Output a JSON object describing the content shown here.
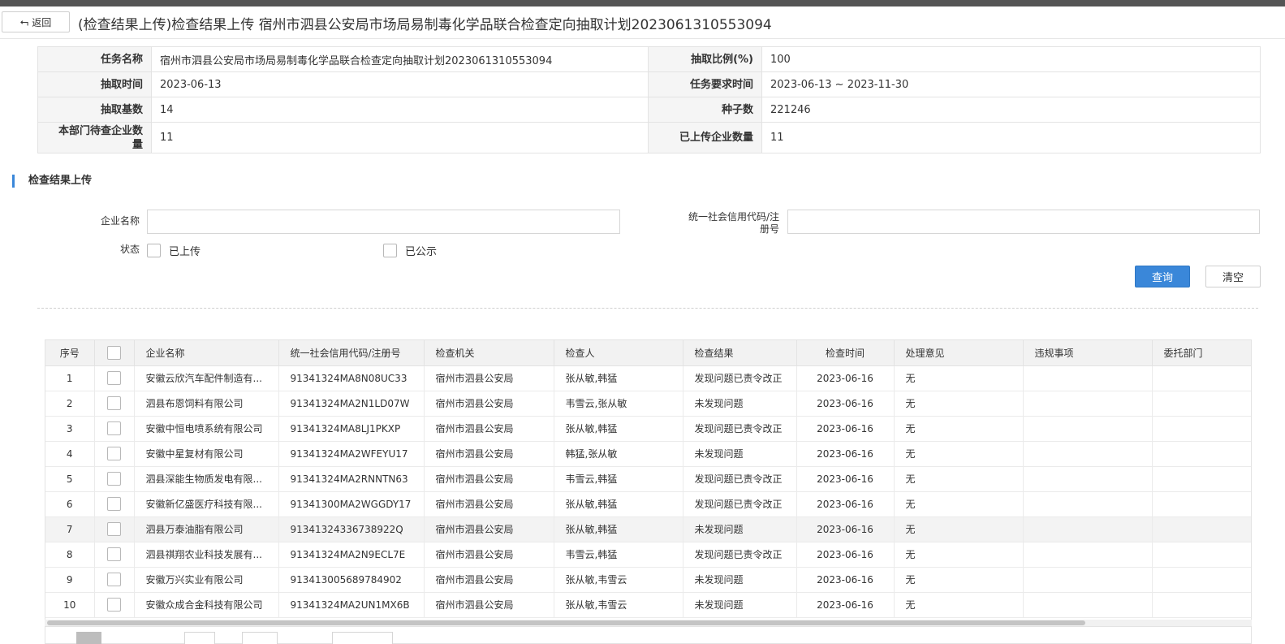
{
  "header": {
    "back_label": "返回",
    "title": "(检查结果上传)检查结果上传 宿州市泗县公安局市场局易制毒化学品联合检查定向抽取计划2023061310553094"
  },
  "info": {
    "task_name_label": "任务名称",
    "task_name": "宿州市泗县公安局市场局易制毒化学品联合检查定向抽取计划2023061310553094",
    "ratio_label": "抽取比例(%)",
    "ratio": "100",
    "extract_time_label": "抽取时间",
    "extract_time": "2023-06-13",
    "required_time_label": "任务要求时间",
    "required_time": "2023-06-13 ~ 2023-11-30",
    "base_count_label": "抽取基数",
    "base_count": "14",
    "seed_label": "种子数",
    "seed": "221246",
    "pending_label_1": "本部门待查企业数",
    "pending_label_2": "量",
    "pending": "11",
    "uploaded_label": "已上传企业数量",
    "uploaded": "11"
  },
  "section": {
    "title": "检查结果上传"
  },
  "filters": {
    "company_label": "企业名称",
    "company_value": "",
    "credit_label_1": "统一社会信用代码/注",
    "credit_label_2": "册号",
    "credit_value": "",
    "status_label": "状态",
    "status_uploaded": "已上传",
    "status_published": "已公示",
    "query_label": "查询",
    "clear_label": "清空"
  },
  "table": {
    "headers": [
      "序号",
      "",
      "企业名称",
      "统一社会信用代码/注册号",
      "检查机关",
      "检查人",
      "检查结果",
      "检查时间",
      "处理意见",
      "违规事项",
      "委托部门"
    ],
    "rows": [
      {
        "no": "1",
        "company": "安徽云欣汽车配件制造有...",
        "code": "91341324MA8N08UC33",
        "org": "宿州市泗县公安局",
        "inspector": "张从敏,韩猛",
        "result": "发现问题已责令改正",
        "time": "2023-06-16",
        "opinion": "无",
        "violation": "",
        "dept": ""
      },
      {
        "no": "2",
        "company": "泗县布恩饲料有限公司",
        "code": "91341324MA2N1LD07W",
        "org": "宿州市泗县公安局",
        "inspector": "韦雪云,张从敏",
        "result": "未发现问题",
        "time": "2023-06-16",
        "opinion": "无",
        "violation": "",
        "dept": ""
      },
      {
        "no": "3",
        "company": "安徽中恒电喷系统有限公司",
        "code": "91341324MA8LJ1PKXP",
        "org": "宿州市泗县公安局",
        "inspector": "张从敏,韩猛",
        "result": "发现问题已责令改正",
        "time": "2023-06-16",
        "opinion": "无",
        "violation": "",
        "dept": ""
      },
      {
        "no": "4",
        "company": "安徽中星复材有限公司",
        "code": "91341324MA2WFEYU17",
        "org": "宿州市泗县公安局",
        "inspector": "韩猛,张从敏",
        "result": "未发现问题",
        "time": "2023-06-16",
        "opinion": "无",
        "violation": "",
        "dept": ""
      },
      {
        "no": "5",
        "company": "泗县深能生物质发电有限...",
        "code": "91341324MA2RNNTN63",
        "org": "宿州市泗县公安局",
        "inspector": "韦雪云,韩猛",
        "result": "发现问题已责令改正",
        "time": "2023-06-16",
        "opinion": "无",
        "violation": "",
        "dept": ""
      },
      {
        "no": "6",
        "company": "安徽新亿盛医疗科技有限...",
        "code": "91341300MA2WGGDY17",
        "org": "宿州市泗县公安局",
        "inspector": "张从敏,韩猛",
        "result": "发现问题已责令改正",
        "time": "2023-06-16",
        "opinion": "无",
        "violation": "",
        "dept": ""
      },
      {
        "no": "7",
        "company": "泗县万泰油脂有限公司",
        "code": "91341324336738922Q",
        "org": "宿州市泗县公安局",
        "inspector": "张从敏,韩猛",
        "result": "未发现问题",
        "time": "2023-06-16",
        "opinion": "无",
        "violation": "",
        "dept": ""
      },
      {
        "no": "8",
        "company": "泗县祺翔农业科技发展有...",
        "code": "91341324MA2N9ECL7E",
        "org": "宿州市泗县公安局",
        "inspector": "韦雪云,韩猛",
        "result": "发现问题已责令改正",
        "time": "2023-06-16",
        "opinion": "无",
        "violation": "",
        "dept": ""
      },
      {
        "no": "9",
        "company": "安徽万兴实业有限公司",
        "code": "913413005689784902",
        "org": "宿州市泗县公安局",
        "inspector": "张从敏,韦雪云",
        "result": "未发现问题",
        "time": "2023-06-16",
        "opinion": "无",
        "violation": "",
        "dept": ""
      },
      {
        "no": "10",
        "company": "安徽众成合金科技有限公司",
        "code": "91341324MA2UN1MX6B",
        "org": "宿州市泗县公安局",
        "inspector": "张从敏,韦雪云",
        "result": "未发现问题",
        "time": "2023-06-16",
        "opinion": "无",
        "violation": "",
        "dept": ""
      }
    ]
  }
}
